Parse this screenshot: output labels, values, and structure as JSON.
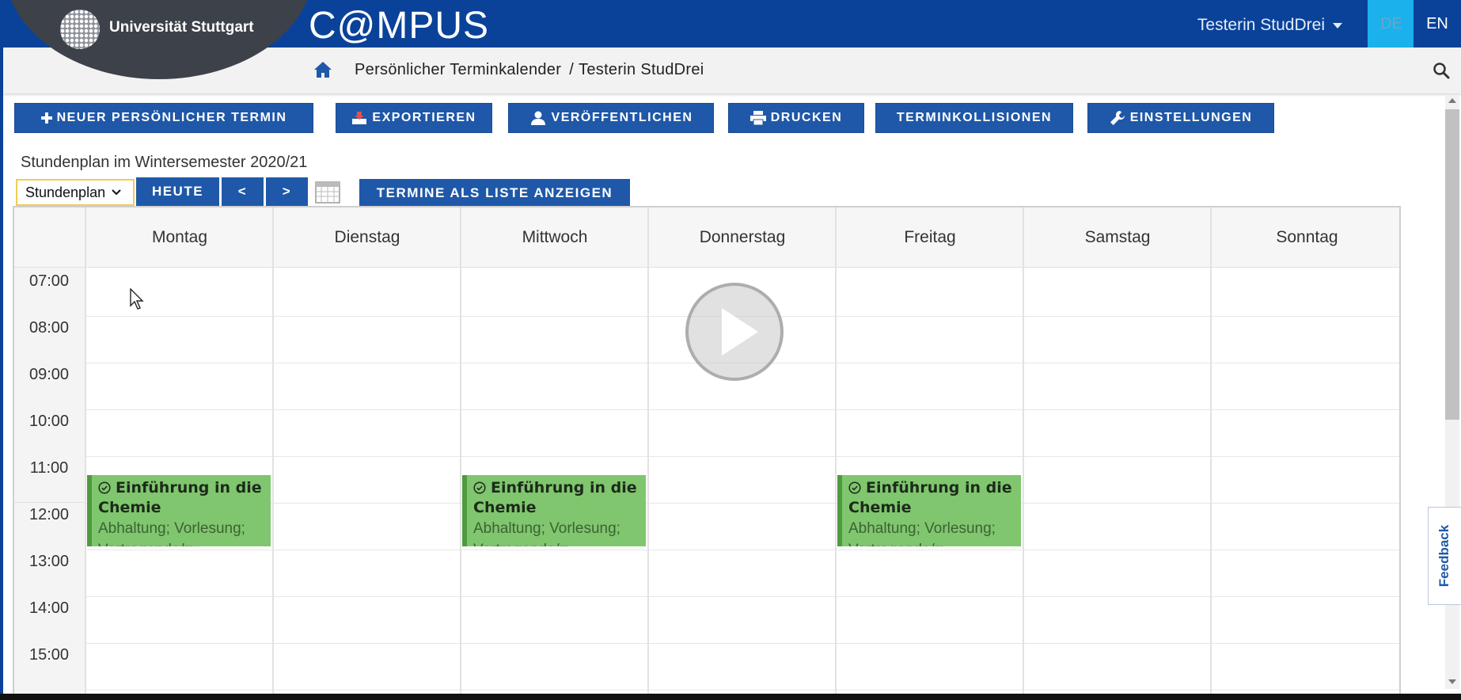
{
  "header": {
    "university": "Universität Stuttgart",
    "app_title": "C@MPUS",
    "user": "Testerin StudDrei",
    "lang_de": "DE",
    "lang_en": "EN"
  },
  "breadcrumb": {
    "title": "Persönlicher Terminkalender",
    "separator": "/",
    "user": "Testerin StudDrei"
  },
  "toolbar": {
    "new_appointment": "NEUER PERSÖNLICHER TERMIN",
    "export": "EXPORTIEREN",
    "publish": "VERÖFFENTLICHEN",
    "print": "DRUCKEN",
    "collisions": "TERMINKOLLISIONEN",
    "settings": "EINSTELLUNGEN"
  },
  "schedule": {
    "semester_label": "Stundenplan im Wintersemester 2020/21",
    "view_selected": "Stundenplan",
    "today": "HEUTE",
    "prev": "<",
    "next": ">",
    "list_view": "TERMINE ALS LISTE ANZEIGEN"
  },
  "calendar": {
    "days": [
      "Montag",
      "Dienstag",
      "Mittwoch",
      "Donnerstag",
      "Freitag",
      "Samstag",
      "Sonntag"
    ],
    "times": [
      "07:00",
      "08:00",
      "09:00",
      "10:00",
      "11:00",
      "12:00",
      "13:00",
      "14:00",
      "15:00"
    ],
    "events": [
      {
        "title": "Einführung in die Chemie",
        "detail": "Abhaltung; Vorlesung; Vortragende/r:"
      },
      {
        "title": "Einführung in die Chemie",
        "detail": "Abhaltung; Vorlesung; Vortragende/r:"
      },
      {
        "title": "Einführung in die Chemie",
        "detail": "Abhaltung; Vorlesung; Vortragende/r:"
      }
    ],
    "event_color": "#7fc66e"
  },
  "feedback": "Feedback",
  "colors": {
    "brand": "#0a429a",
    "button": "#1f58a8",
    "lang_active": "#1bb1ec"
  }
}
